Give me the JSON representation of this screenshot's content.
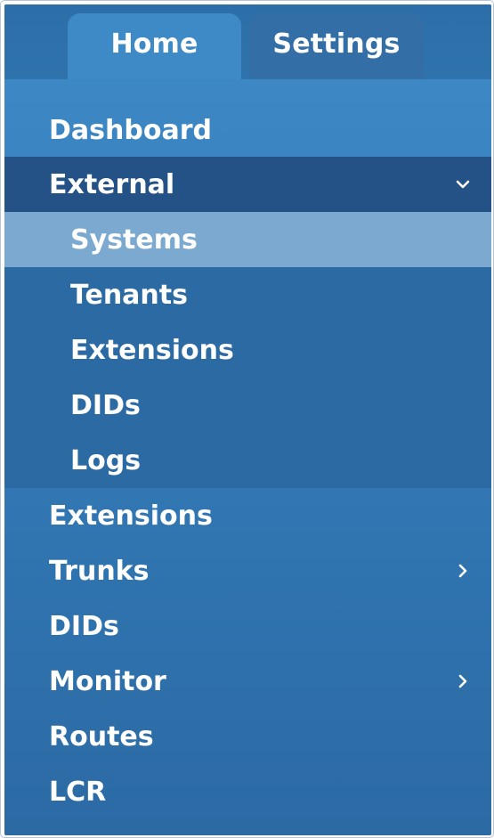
{
  "tabs": [
    {
      "label": "Home",
      "active": true
    },
    {
      "label": "Settings",
      "active": false
    }
  ],
  "menu": {
    "dashboard": "Dashboard",
    "external": {
      "label": "External",
      "expanded": true,
      "icon": "chevron-down-icon",
      "children": [
        "Systems",
        "Tenants",
        "Extensions",
        "DIDs",
        "Logs"
      ],
      "selected_child": "Systems"
    },
    "extensions": "Extensions",
    "trunks": {
      "label": "Trunks",
      "icon": "chevron-right-icon"
    },
    "dids": "DIDs",
    "monitor": {
      "label": "Monitor",
      "icon": "chevron-right-icon"
    },
    "routes": "Routes",
    "lcr": "LCR"
  },
  "colors": {
    "panel": "#3780bd",
    "active_parent": "#245286",
    "selected": "#7ba9cf",
    "text": "#ffffff"
  }
}
